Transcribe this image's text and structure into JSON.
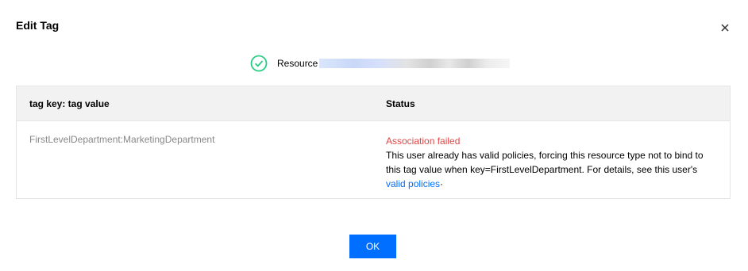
{
  "dialog": {
    "title": "Edit Tag",
    "close_icon": "close-icon"
  },
  "resource": {
    "icon": "check-circle-icon",
    "label": "Resource"
  },
  "table": {
    "headers": {
      "key": "tag key: tag value",
      "status": "Status"
    },
    "rows": [
      {
        "tag": "FirstLevelDepartment:MarketingDepartment",
        "status_title": "Association failed",
        "status_desc": "This user already has valid policies, forcing this resource type not to bind to this tag value when key=FirstLevelDepartment. For details, see this user's",
        "link": "valid policies",
        "link_suffix": "·"
      }
    ]
  },
  "footer": {
    "ok_label": "OK"
  },
  "colors": {
    "primary": "#006eff",
    "error": "#e54545",
    "success": "#29cc85"
  }
}
